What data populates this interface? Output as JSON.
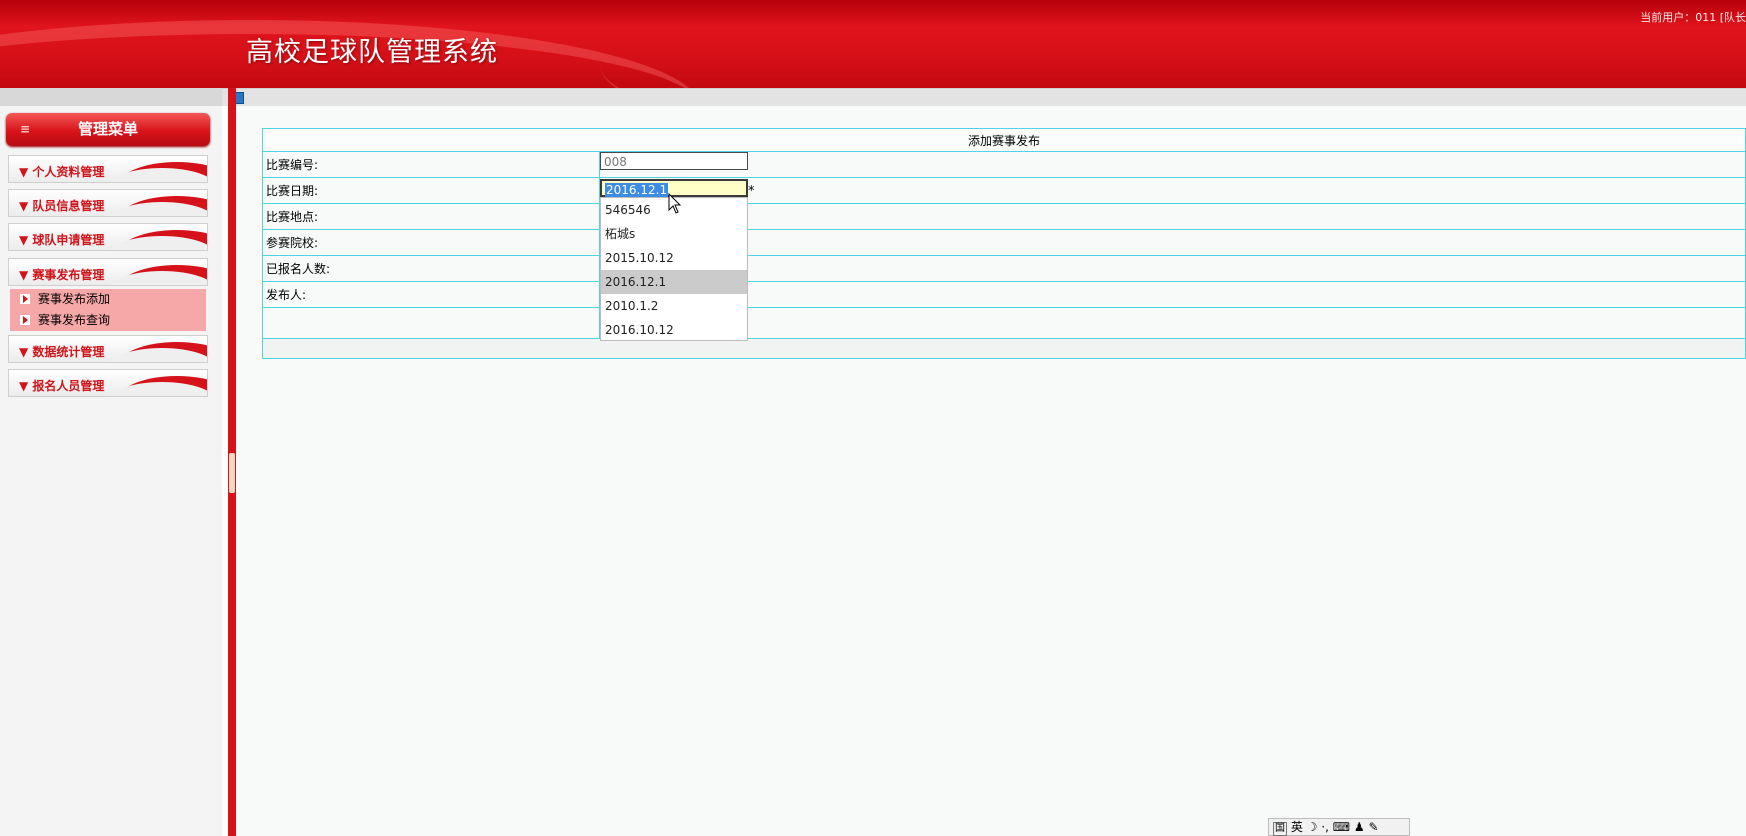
{
  "header": {
    "title": "高校足球队管理系统",
    "current_user": "当前用户：011 [队长"
  },
  "sidebar": {
    "menu_title": "管理菜单",
    "items": [
      {
        "label": "个人资料管理"
      },
      {
        "label": "队员信息管理"
      },
      {
        "label": "球队申请管理"
      },
      {
        "label": "赛事发布管理"
      },
      {
        "label": "数据统计管理"
      },
      {
        "label": "报名人员管理"
      }
    ],
    "subitems": [
      {
        "label": "赛事发布添加"
      },
      {
        "label": "赛事发布查询"
      }
    ]
  },
  "form": {
    "title": "添加赛事发布",
    "fields": [
      {
        "label": "比赛编号:"
      },
      {
        "label": "比赛日期:"
      },
      {
        "label": "比赛地点:"
      },
      {
        "label": "参赛院校:"
      },
      {
        "label": "已报名人数:"
      },
      {
        "label": "发布人:"
      }
    ],
    "match_id_value": "008",
    "match_date_value": "2016.12.1",
    "required_mark": "*"
  },
  "autocomplete": {
    "options": [
      "546546",
      "柘城s",
      "2015.10.12",
      "2016.12.1",
      "2010.1.2",
      "2016.10.12"
    ],
    "highlighted": "2016.12.1"
  },
  "ime_bar": {
    "mode": "国",
    "lang": "英"
  },
  "colors": {
    "brand_red": "#d40f17",
    "table_border": "#4fd4e0",
    "input_active_bg": "#ffffc6"
  }
}
